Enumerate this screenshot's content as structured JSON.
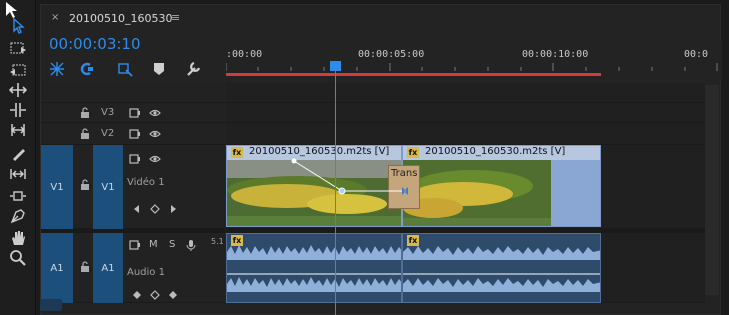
{
  "tab": {
    "close": "×",
    "title": "20100510_160530",
    "menu": "≡"
  },
  "timecode": "00:00:03:10",
  "ruler": {
    "labels": [
      ":00:00",
      "00:00:05:00",
      "00:00:10:00",
      "00:0"
    ]
  },
  "tracks": {
    "v3": {
      "name": "V3"
    },
    "v2": {
      "name": "V2"
    },
    "v1": {
      "source": "V1",
      "name": "V1",
      "label": "Vidéo 1"
    },
    "a1": {
      "source": "A1",
      "name": "A1",
      "label": "Audio 1",
      "mute": "M",
      "solo": "S",
      "level": "5.1"
    }
  },
  "clips": {
    "video_left": "20100510_160530.m2ts [V]",
    "video_right": "20100510_160530.m2ts [V]",
    "fx": "fx",
    "transition": "Trans"
  },
  "colors": {
    "accent": "#2d8ceb",
    "work_area": "#d63b3b",
    "clip_title": "#b7c7e0",
    "audio": "#2f4b6b"
  }
}
